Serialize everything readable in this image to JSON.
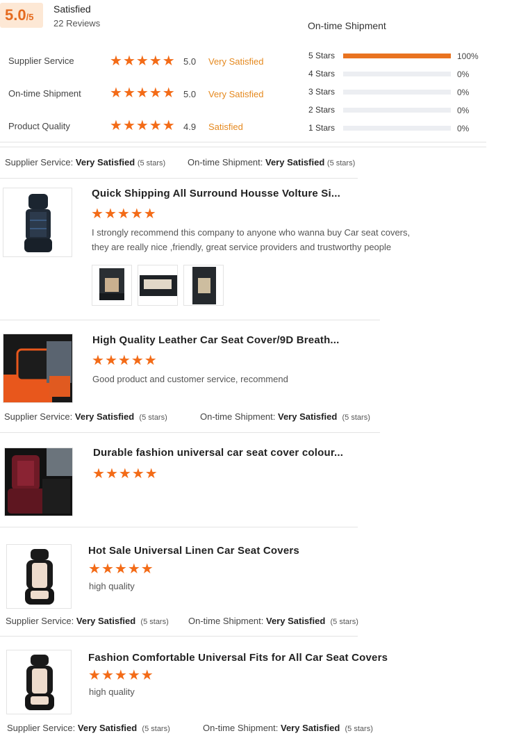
{
  "overall": {
    "score": "5.0",
    "score_suffix": "/5",
    "label": "Satisfied",
    "reviews": "22 Reviews"
  },
  "metrics": [
    {
      "label": "Supplier Service",
      "score": "5.0",
      "rating": "Very Satisfied",
      "stars": 5
    },
    {
      "label": "On-time Shipment",
      "score": "5.0",
      "rating": "Very Satisfied",
      "stars": 5
    },
    {
      "label": "Product Quality",
      "score": "4.9",
      "rating": "Satisfied",
      "stars": 5
    }
  ],
  "distribution": {
    "title": "On-time Shipment",
    "rows": [
      {
        "label": "5 Stars",
        "percent": "100%",
        "fraction": 1.0
      },
      {
        "label": "4 Stars",
        "percent": "0%",
        "fraction": 0
      },
      {
        "label": "3 Stars",
        "percent": "0%",
        "fraction": 0
      },
      {
        "label": "2 Stars",
        "percent": "0%",
        "fraction": 0
      },
      {
        "label": "1 Stars",
        "percent": "0%",
        "fraction": 0
      }
    ]
  },
  "summary_labels": {
    "supplier": "Supplier Service:",
    "shipment": "On-time Shipment:",
    "value": "Very Satisfied",
    "stars": "(5 stars)"
  },
  "reviews": [
    {
      "title": "Quick Shipping All Surround Housse Volture Si...",
      "stars": 5,
      "text_lines": [
        "I strongly recommend this company to anyone who wanna buy Car seat covers,",
        "they are really nice ,friendly, great service providers and trustworthy people"
      ]
    },
    {
      "title": "High Quality Leather Car Seat Cover/9D Breath...",
      "stars": 5,
      "text_lines": [
        "Good product and customer service, recommend"
      ]
    },
    {
      "title": "Durable fashion universal car seat cover colour...",
      "stars": 5,
      "text_lines": []
    },
    {
      "title": "Hot Sale Universal Linen Car Seat Covers",
      "stars": 5,
      "text_lines": [
        "high quality"
      ]
    },
    {
      "title": "Fashion Comfortable Universal Fits for All Car Seat Covers",
      "stars": 5,
      "text_lines": [
        "high quality"
      ]
    }
  ],
  "icons": {
    "star": "star-icon"
  },
  "colors": {
    "accent": "#f36b17",
    "badge_bg": "#fde8d5",
    "rating_text": "#e5891f"
  }
}
